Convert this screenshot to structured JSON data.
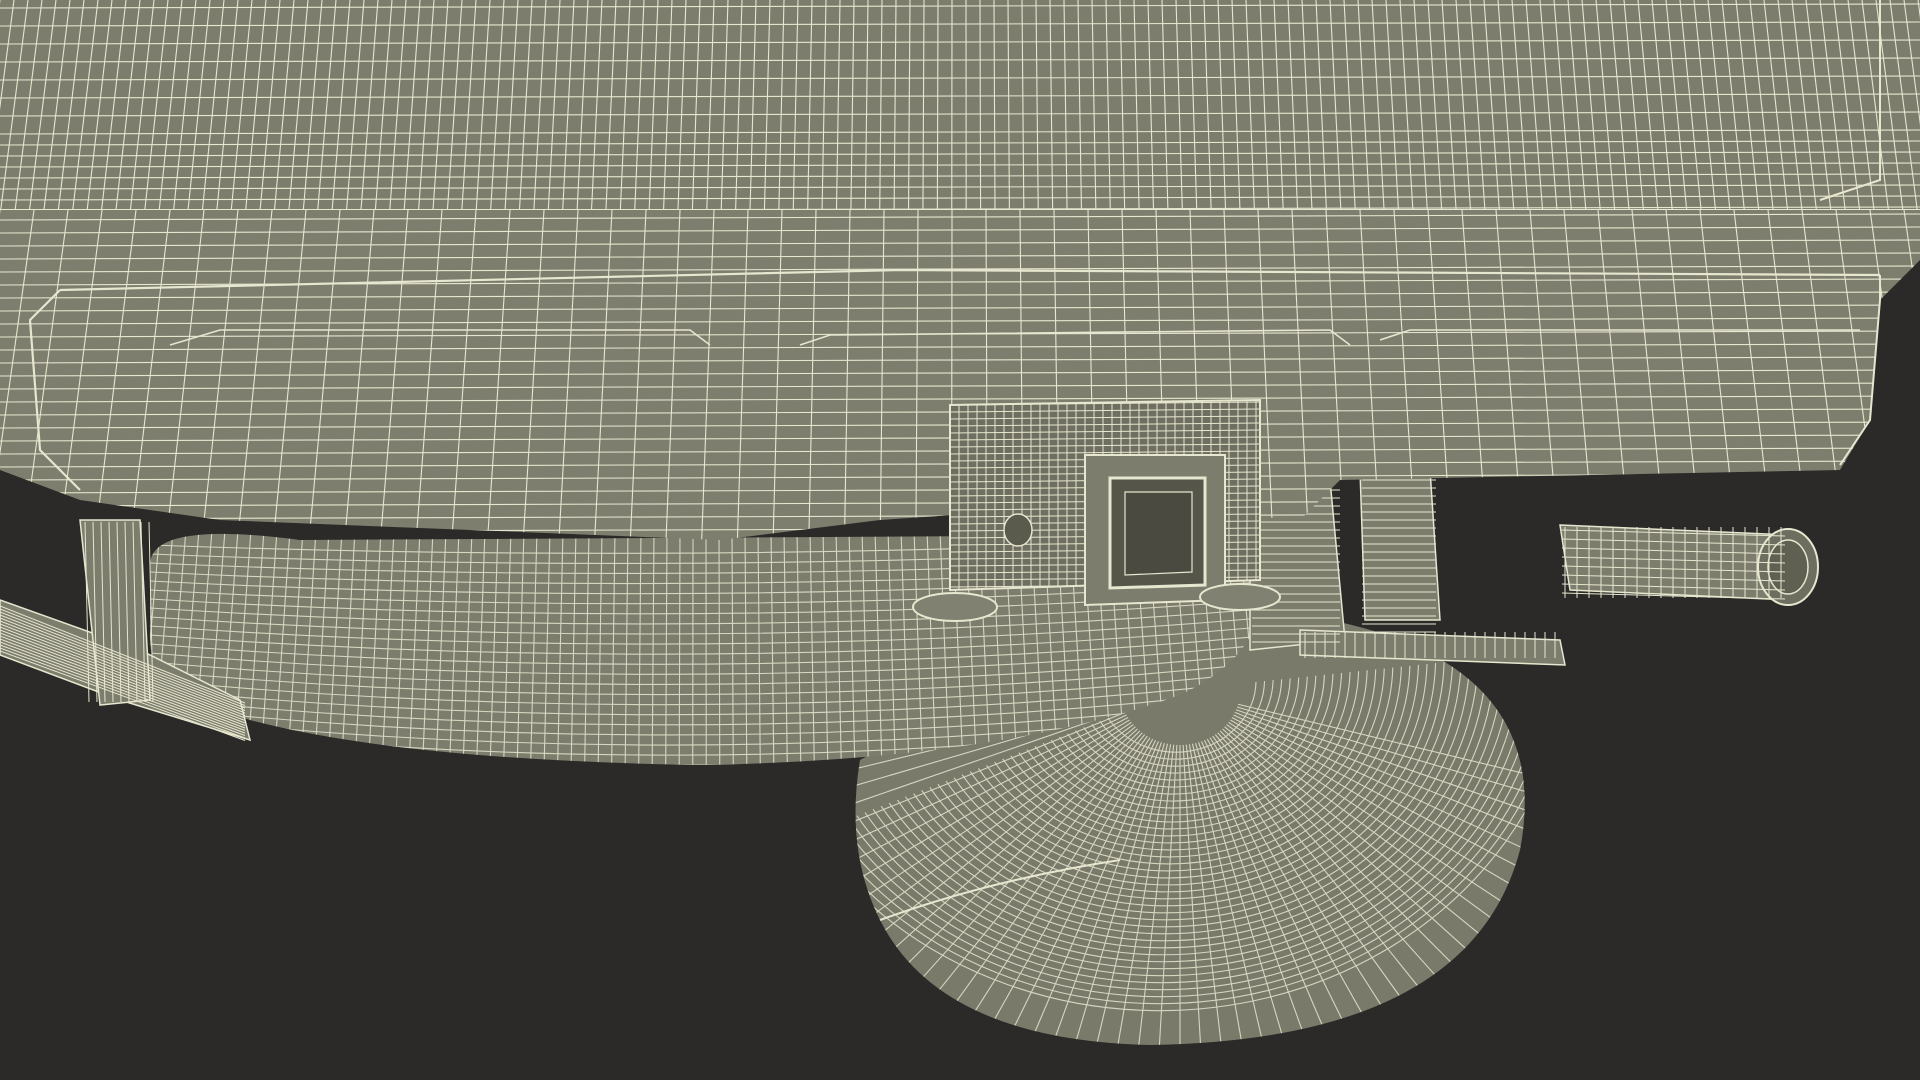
{
  "scene": {
    "background_color": "#2b2a28",
    "surface_color": "#7d7d6e",
    "surface_dark": "#6e6e60",
    "surface_light": "#8a8a7a",
    "wire_color": "#e7e6cf",
    "components": [
      "body-panel",
      "rear-bumper",
      "tow-hitch-receiver",
      "spare-tire",
      "exhaust-pipe",
      "suspension-bracket",
      "leaf-spring"
    ]
  }
}
